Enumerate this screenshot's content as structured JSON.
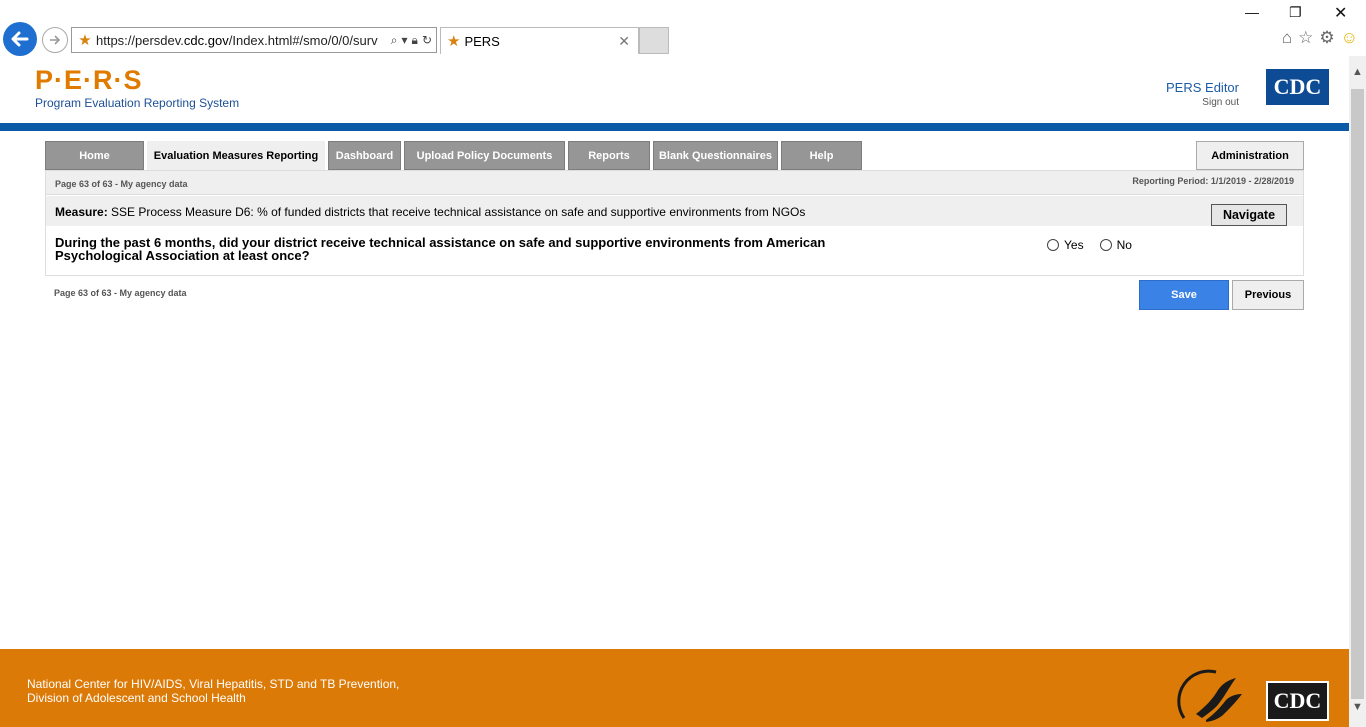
{
  "browser": {
    "url_prefix": "https://persdev.",
    "url_host": "cdc.gov",
    "url_path": "/Index.html#/smo/0/0/surv",
    "tab_title": "PERS"
  },
  "header": {
    "logo_text": "P·E·R·S",
    "subtitle": "Program Evaluation Reporting System",
    "user_name": "PERS Editor",
    "sign_out": "Sign out",
    "cdc_logo": "CDC"
  },
  "nav": {
    "items": [
      {
        "label": "Home",
        "active": false
      },
      {
        "label": "Evaluation Measures Reporting",
        "active": true
      },
      {
        "label": "Dashboard",
        "active": false
      },
      {
        "label": "Upload Policy Documents",
        "active": false
      },
      {
        "label": "Reports",
        "active": false
      },
      {
        "label": "Blank Questionnaires",
        "active": false
      },
      {
        "label": "Help",
        "active": false
      }
    ],
    "admin": "Administration"
  },
  "panel": {
    "page_info": "Page 63 of 63 - My agency data",
    "reporting_period": "Reporting Period: 1/1/2019 - 2/28/2019",
    "measure_label": "Measure:",
    "measure_text": "SSE Process Measure D6: % of funded districts that receive technical assistance on safe and supportive environments from NGOs",
    "navigate": "Navigate",
    "question": "During the past 6 months, did your district receive technical assistance on safe and supportive environments from American Psychological Association at least once?",
    "options": [
      "Yes",
      "No"
    ]
  },
  "actions": {
    "page_info": "Page 63 of 63 - My agency data",
    "save": "Save",
    "previous": "Previous"
  },
  "footer": {
    "line1": "National Center for HIV/AIDS, Viral Hepatitis, STD and TB Prevention,",
    "line2": "Division of Adolescent and School Health",
    "cdc_logo": "CDC"
  }
}
